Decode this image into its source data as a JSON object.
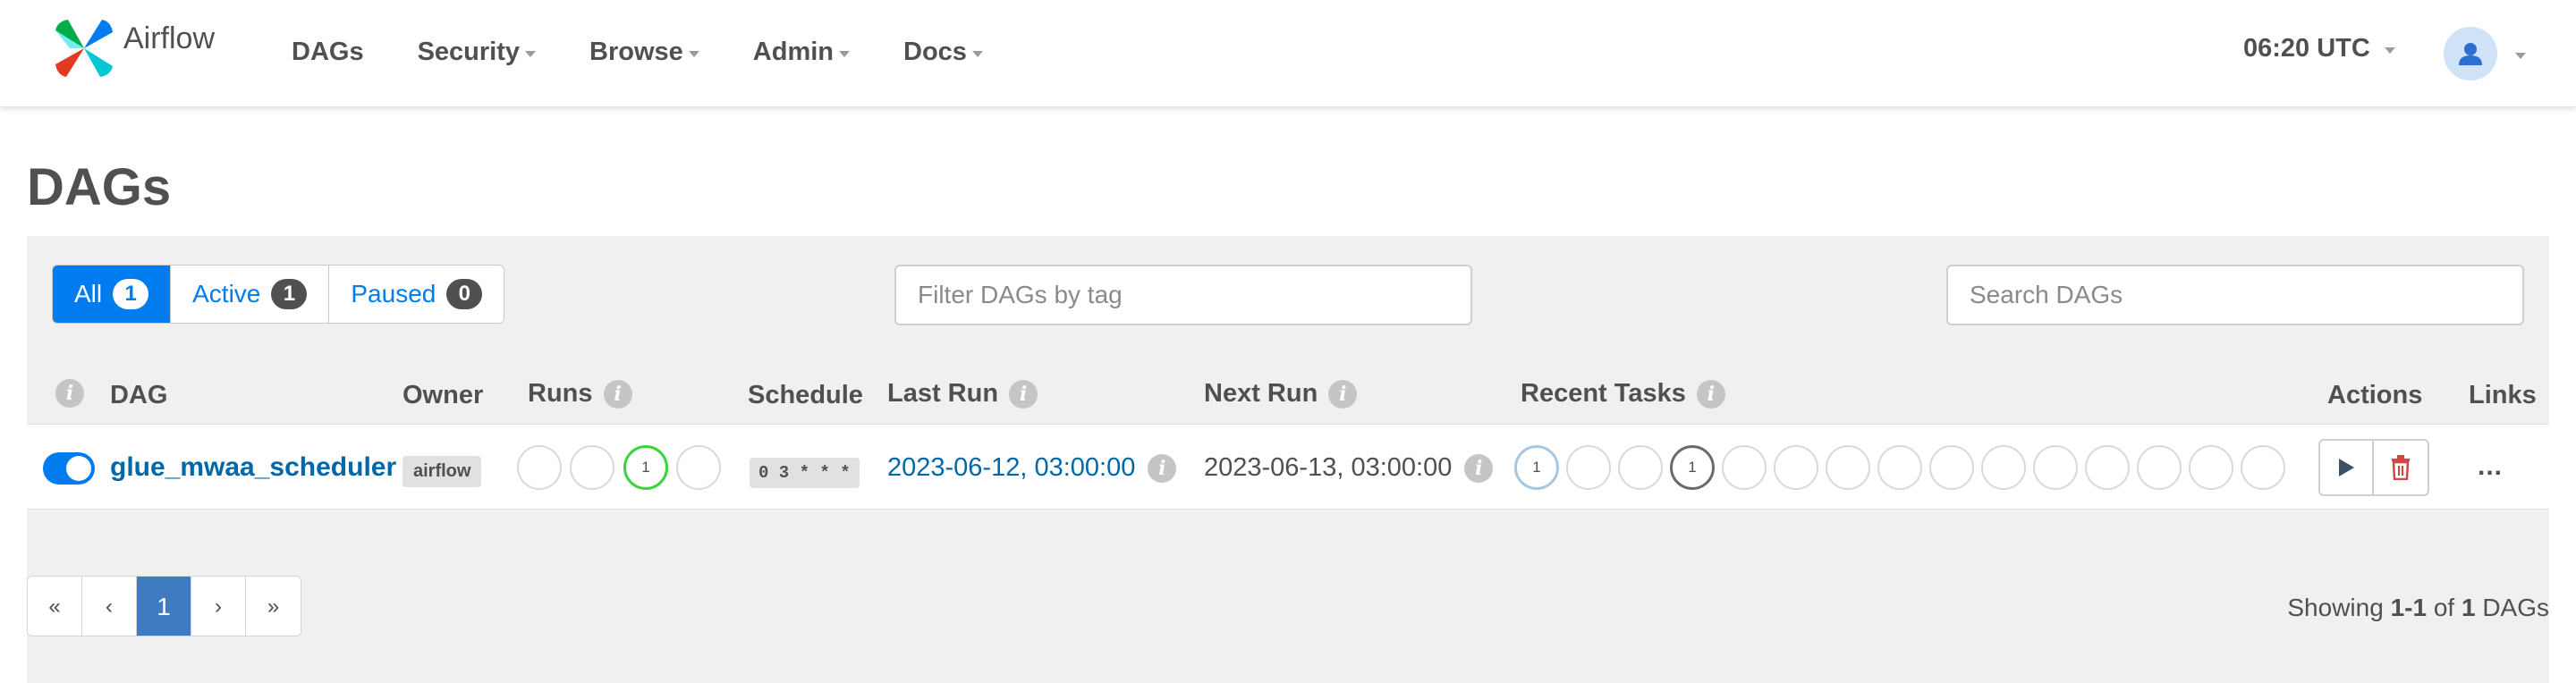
{
  "brand": {
    "name": "Airflow"
  },
  "nav": {
    "items": [
      {
        "label": "DAGs",
        "dropdown": false
      },
      {
        "label": "Security",
        "dropdown": true
      },
      {
        "label": "Browse",
        "dropdown": true
      },
      {
        "label": "Admin",
        "dropdown": true
      },
      {
        "label": "Docs",
        "dropdown": true
      }
    ],
    "clock": "06:20 UTC",
    "user_icon": "user-icon"
  },
  "page": {
    "title": "DAGs"
  },
  "filters": {
    "all": {
      "label": "All",
      "count": "1"
    },
    "active": {
      "label": "Active",
      "count": "1"
    },
    "paused": {
      "label": "Paused",
      "count": "0"
    },
    "tag_placeholder": "Filter DAGs by tag",
    "search_placeholder": "Search DAGs"
  },
  "table": {
    "headers": {
      "dag": "DAG",
      "owner": "Owner",
      "runs": "Runs",
      "schedule": "Schedule",
      "last_run": "Last Run",
      "next_run": "Next Run",
      "recent_tasks": "Recent Tasks",
      "actions": "Actions",
      "links": "Links"
    },
    "rows": [
      {
        "dag_id": "glue_mwaa_scheduler",
        "paused": false,
        "owner": "airflow",
        "runs": [
          "",
          "",
          "1",
          ""
        ],
        "schedule": "0 3 * * *",
        "last_run": "2023-06-12, 03:00:00",
        "next_run": "2023-06-13, 03:00:00",
        "recent_tasks": [
          "1",
          "",
          "",
          "1",
          "",
          "",
          "",
          "",
          "",
          "",
          "",
          "",
          "",
          "",
          ""
        ],
        "links_label": "..."
      }
    ]
  },
  "pagination": {
    "first": "«",
    "prev": "‹",
    "current": "1",
    "next": "›",
    "last": "»"
  },
  "summary": {
    "prefix": "Showing",
    "range": "1-1",
    "of": "of",
    "total": "1",
    "suffix": "DAGs"
  },
  "colors": {
    "primary": "#017cee",
    "run_success": "#39d43a",
    "task_queued": "#a8c7df",
    "task_running_border": "#6a6a6a",
    "delete": "#d64545",
    "link": "#0067a8"
  }
}
